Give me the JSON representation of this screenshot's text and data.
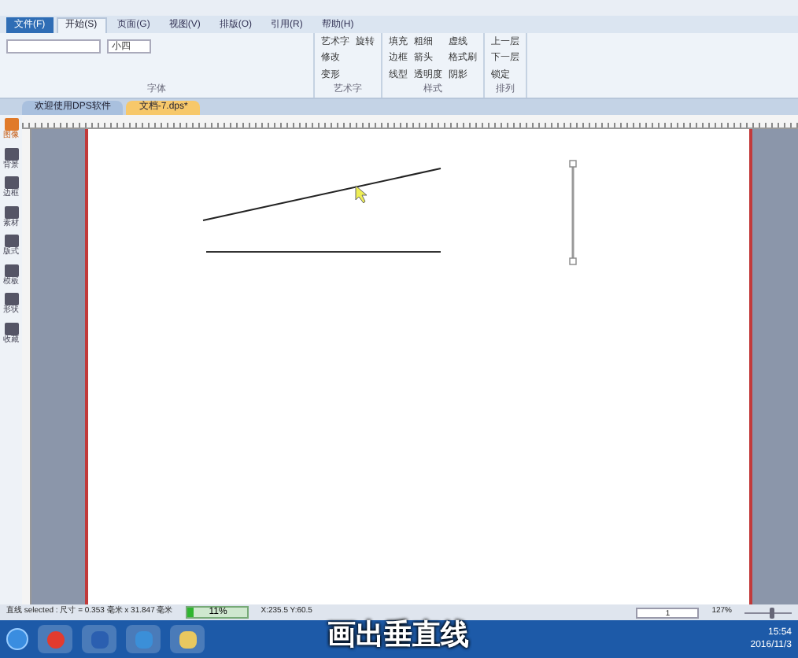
{
  "menu_tabs": [
    {
      "label": "文件(F)",
      "selected": false
    },
    {
      "label": "开始(S)",
      "selected": true
    },
    {
      "label": "页面(G)",
      "selected": false
    },
    {
      "label": "视图(V)",
      "selected": false
    },
    {
      "label": "排版(O)",
      "selected": false
    },
    {
      "label": "引用(R)",
      "selected": false
    },
    {
      "label": "帮助(H)",
      "selected": false
    }
  ],
  "ribbon": {
    "font_size": "小四",
    "groups": [
      {
        "label": "字体"
      },
      {
        "label": "艺术字",
        "buttons": [
          "艺术字",
          "修改",
          "变形",
          "旋转"
        ]
      },
      {
        "label": "样式",
        "buttons": [
          "填充",
          "边框",
          "线型",
          "粗细",
          "箭头",
          "透明度",
          "虚线",
          "格式刷",
          "阴影"
        ]
      },
      {
        "label": "排列",
        "buttons": [
          "上一层",
          "下一层",
          "锁定"
        ]
      }
    ]
  },
  "doc_tabs": [
    {
      "label": "欢迎使用DPS软件",
      "selected": false
    },
    {
      "label": "文档-7.dps*",
      "selected": true
    }
  ],
  "side_tools": [
    {
      "label": "图像",
      "selected": true
    },
    {
      "label": "背景",
      "selected": false
    },
    {
      "label": "边框",
      "selected": false
    },
    {
      "label": "素材",
      "selected": false
    },
    {
      "label": "版式",
      "selected": false
    },
    {
      "label": "模板",
      "selected": false
    },
    {
      "label": "形状",
      "selected": false
    },
    {
      "label": "收藏",
      "selected": false
    }
  ],
  "status_bar": {
    "selection": "直线 selected : 尺寸 = 0.353 毫米 x 31.847 毫米",
    "progress": {
      "level": 0.11,
      "label": "11%"
    },
    "coords": "X:235.5 Y:60.5",
    "page": "1",
    "zoom": "127%",
    "zoom_slider": {
      "level": 0.6
    }
  },
  "caption": "画出垂直线",
  "taskbar": {
    "time": "15:54",
    "date": "2016/11/3"
  }
}
